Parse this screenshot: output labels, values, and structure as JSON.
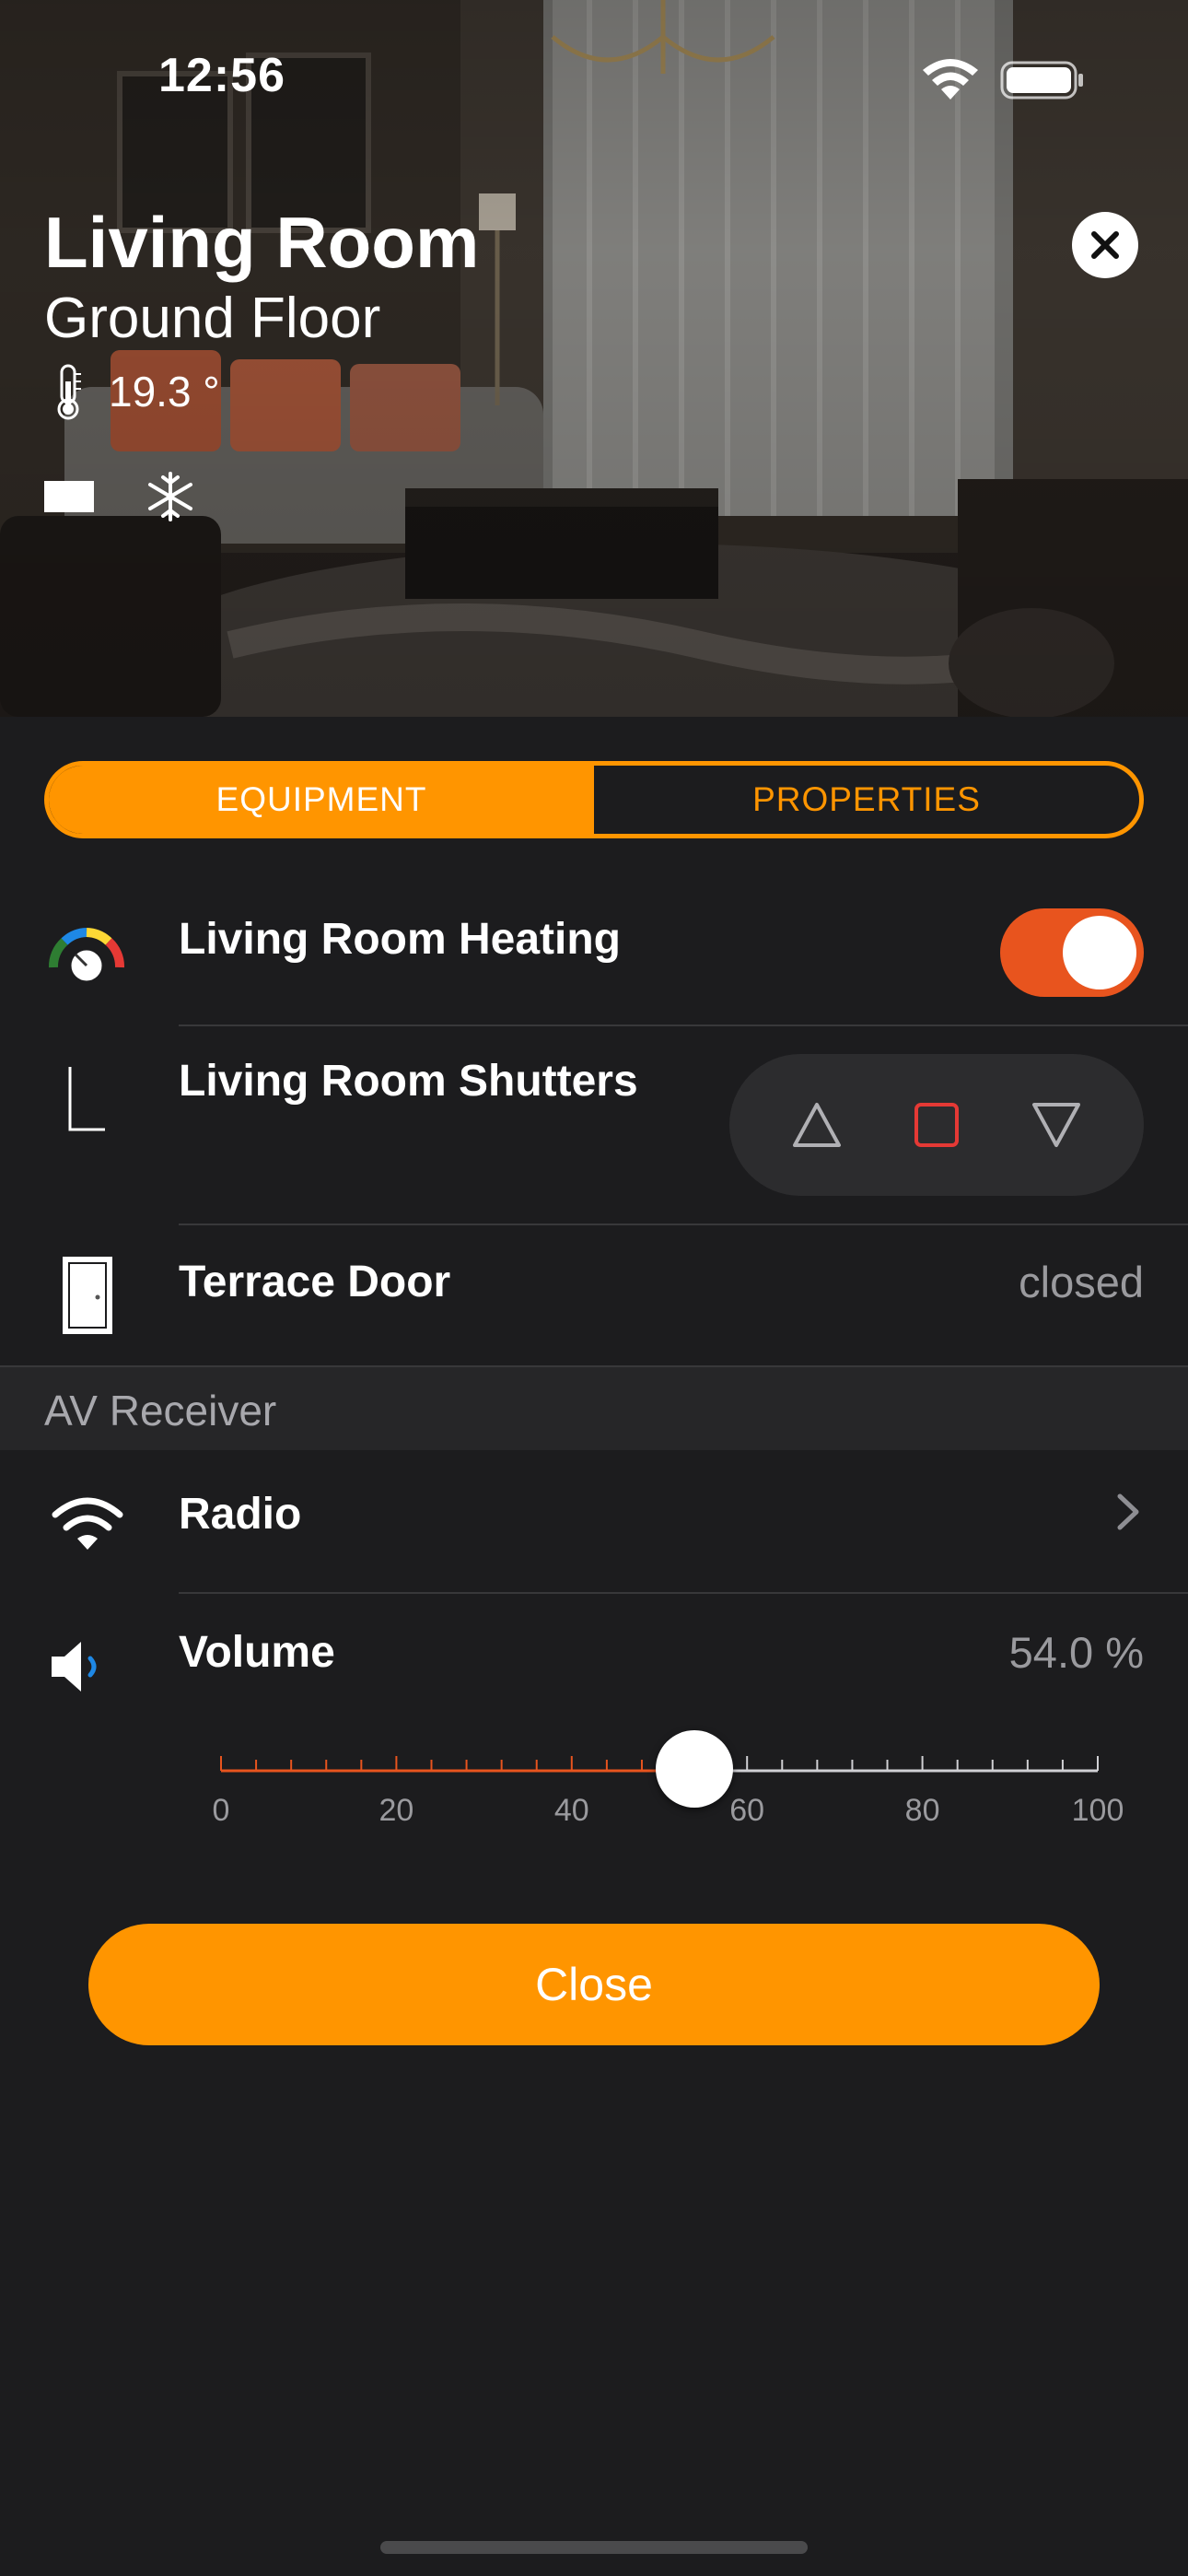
{
  "status_bar": {
    "time": "12:56"
  },
  "room": {
    "name": "Living Room",
    "floor": "Ground Floor",
    "temperature": "19.3 °"
  },
  "tabs": [
    {
      "label": "EQUIPMENT",
      "active": true
    },
    {
      "label": "PROPERTIES",
      "active": false
    }
  ],
  "equipment": {
    "heating": {
      "label": "Living Room Heating",
      "on": true
    },
    "shutters": {
      "label": "Living Room Shutters",
      "buttons": [
        "up-icon",
        "stop-icon",
        "down-icon"
      ]
    },
    "door": {
      "label": "Terrace Door",
      "value": "closed"
    }
  },
  "section": {
    "title": "AV Receiver"
  },
  "av": {
    "radio": {
      "label": "Radio"
    },
    "volume": {
      "label": "Volume",
      "value_text": "54.0 %",
      "value": 54.0,
      "min": 0,
      "max": 100,
      "tick_labels": [
        "0",
        "20",
        "40",
        "60",
        "80",
        "100"
      ]
    }
  },
  "close_button": {
    "label": "Close"
  },
  "colors": {
    "accent": "#ff9500",
    "toggle_on": "#e8541e",
    "stop_red": "#e53935",
    "background": "#1c1c1e"
  }
}
